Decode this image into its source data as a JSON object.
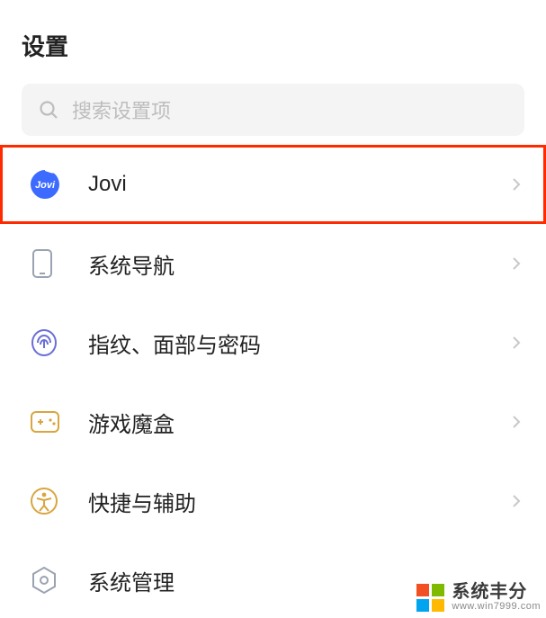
{
  "header": {
    "title": "设置"
  },
  "search": {
    "placeholder": "搜索设置项"
  },
  "items": [
    {
      "key": "jovi",
      "label": "Jovi",
      "highlighted": true
    },
    {
      "key": "system-navigation",
      "label": "系统导航",
      "highlighted": false
    },
    {
      "key": "fingerprint-face-password",
      "label": "指纹、面部与密码",
      "highlighted": false
    },
    {
      "key": "game-box",
      "label": "游戏魔盒",
      "highlighted": false
    },
    {
      "key": "shortcut-accessibility",
      "label": "快捷与辅助",
      "highlighted": false
    },
    {
      "key": "system-management",
      "label": "系统管理",
      "highlighted": false
    }
  ],
  "watermark": {
    "main": "系统丰分",
    "sub": "www.win7999.com"
  },
  "colors": {
    "highlight": "#ff2a00",
    "text": "#222222",
    "placeholder": "#bdbdbd",
    "search_bg": "#f4f4f4"
  }
}
